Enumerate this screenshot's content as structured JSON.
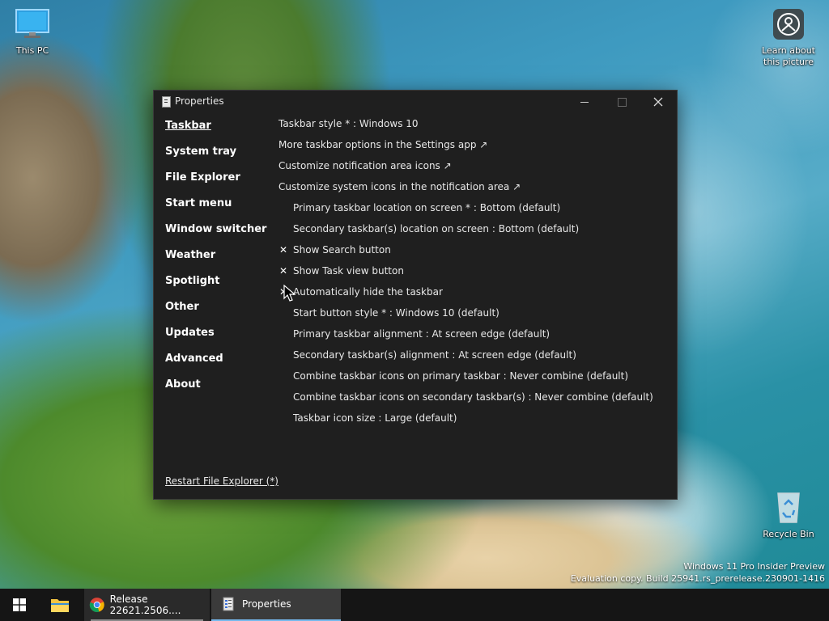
{
  "desktop": {
    "icons": [
      {
        "label": "This PC",
        "icon": "monitor-icon"
      },
      {
        "label": "Learn about this picture",
        "icon": "learn-about-picture-icon"
      },
      {
        "label": "Recycle Bin",
        "icon": "recycle-bin-icon"
      }
    ],
    "watermark": {
      "line1": "Windows 11 Pro Insider Preview",
      "line2": "Evaluation copy. Build 25941.rs_prerelease.230901-1416"
    }
  },
  "window": {
    "title": "Properties",
    "nav": [
      {
        "label": "Taskbar",
        "active": true
      },
      {
        "label": "System tray"
      },
      {
        "label": "File Explorer"
      },
      {
        "label": "Start menu"
      },
      {
        "label": "Window switcher"
      },
      {
        "label": "Weather"
      },
      {
        "label": "Spotlight"
      },
      {
        "label": "Other"
      },
      {
        "label": "Updates"
      },
      {
        "label": "Advanced"
      },
      {
        "label": "About"
      }
    ],
    "options": [
      {
        "label": "Taskbar style * : Windows 10",
        "checked": null
      },
      {
        "label": "More taskbar options in the Settings app ↗",
        "checked": null
      },
      {
        "label": "Customize notification area icons ↗",
        "checked": null
      },
      {
        "label": "Customize system icons in the notification area ↗",
        "checked": null
      },
      {
        "label": "Primary taskbar location on screen * : Bottom (default)",
        "checked": null
      },
      {
        "label": "Secondary taskbar(s) location on screen : Bottom (default)",
        "checked": null
      },
      {
        "label": "Show Search button",
        "checked": "✕"
      },
      {
        "label": "Show Task view button",
        "checked": "✕"
      },
      {
        "label": "Automatically hide the taskbar",
        "checked": "✕"
      },
      {
        "label": "Start button style * : Windows 10 (default)",
        "checked": null
      },
      {
        "label": "Primary taskbar alignment : At screen edge (default)",
        "checked": null
      },
      {
        "label": "Secondary taskbar(s) alignment : At screen edge (default)",
        "checked": null
      },
      {
        "label": "Combine taskbar icons on primary taskbar : Never combine (default)",
        "checked": null
      },
      {
        "label": "Combine taskbar icons on secondary taskbar(s) : Never combine (default)",
        "checked": null
      },
      {
        "label": "Taskbar icon size : Large (default)",
        "checked": null
      }
    ],
    "restart_link": "Restart File Explorer (*)"
  },
  "taskbar": {
    "items": [
      {
        "label": "",
        "icon": "windows-start-icon"
      },
      {
        "label": "",
        "icon": "file-explorer-icon"
      },
      {
        "label": "Release 22621.2506....",
        "icon": "chrome-icon"
      },
      {
        "label": "Properties",
        "icon": "properties-icon"
      }
    ]
  },
  "colors": {
    "window_bg": "#1f1f1f",
    "taskbar_bg": "#151515",
    "active_underline": "#76b9ed"
  }
}
